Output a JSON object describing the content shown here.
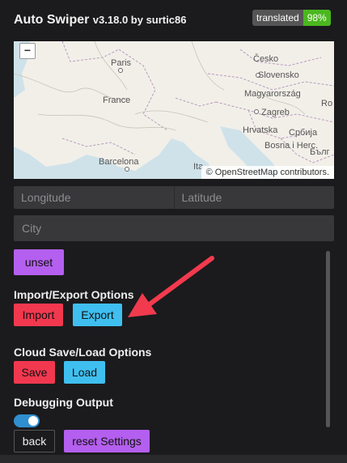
{
  "header": {
    "app_name": "Auto Swiper",
    "version": "v3.18.0 by surtic86",
    "badge_left": "translated",
    "badge_right": "98%"
  },
  "map": {
    "zoom_out": "−",
    "attribution_prefix": "©",
    "attribution_link": "OpenStreetMap",
    "attribution_suffix": "contributors.",
    "labels": [
      "Paris",
      "France",
      "Barcelona",
      "Česko",
      "Slovensko",
      "Magyarország",
      "Zagreb",
      "Hrvatska",
      "Србија",
      "Bosna i Herc.",
      "Ita",
      "Бълг",
      "Ro"
    ]
  },
  "location": {
    "longitude_placeholder": "Longitude",
    "latitude_placeholder": "Latitude",
    "city_placeholder": "City"
  },
  "buttons": {
    "unset": "unset",
    "import": "Import",
    "export": "Export",
    "save": "Save",
    "load": "Load",
    "back": "back",
    "reset": "reset Settings"
  },
  "sections": {
    "import_export": "Import/Export Options",
    "cloud": "Cloud Save/Load Options",
    "debug": "Debugging Output"
  },
  "debug_toggle": {
    "on": true
  },
  "colors": {
    "purple": "#b45fef",
    "red": "#f2384f",
    "blue": "#3fbff0",
    "arrow": "#f23a4e"
  }
}
